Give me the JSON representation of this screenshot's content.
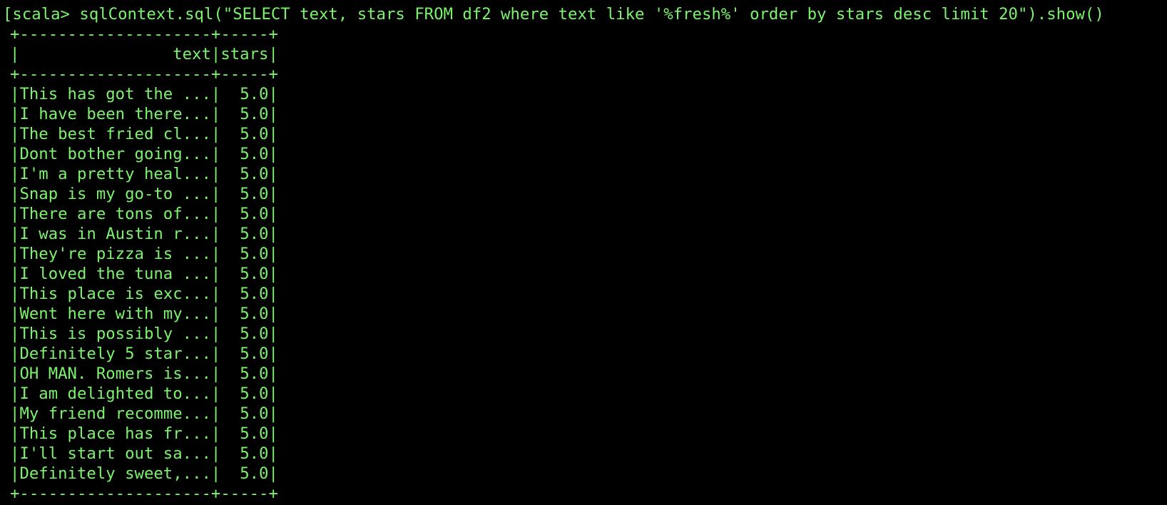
{
  "terminal": {
    "prompt": "[scala> ",
    "command": "sqlContext.sql(\"SELECT text, stars FROM df2 where text like '%fresh%' order by stars desc limit 20\").show()",
    "border": "+--------------------+-----+",
    "header": "|                text|stars|",
    "rows": [
      {
        "text": "This has got the ...",
        "stars": "5.0"
      },
      {
        "text": "I have been there...",
        "stars": "5.0"
      },
      {
        "text": "The best fried cl...",
        "stars": "5.0"
      },
      {
        "text": "Dont bother going...",
        "stars": "5.0"
      },
      {
        "text": "I'm a pretty heal...",
        "stars": "5.0"
      },
      {
        "text": "Snap is my go-to ...",
        "stars": "5.0"
      },
      {
        "text": "There are tons of...",
        "stars": "5.0"
      },
      {
        "text": "I was in Austin r...",
        "stars": "5.0"
      },
      {
        "text": "They're pizza is ...",
        "stars": "5.0"
      },
      {
        "text": "I loved the tuna ...",
        "stars": "5.0"
      },
      {
        "text": "This place is exc...",
        "stars": "5.0"
      },
      {
        "text": "Went here with my...",
        "stars": "5.0"
      },
      {
        "text": "This is possibly ...",
        "stars": "5.0"
      },
      {
        "text": "Definitely 5 star...",
        "stars": "5.0"
      },
      {
        "text": "OH MAN. Romers is...",
        "stars": "5.0"
      },
      {
        "text": "I am delighted to...",
        "stars": "5.0"
      },
      {
        "text": "My friend recomme...",
        "stars": "5.0"
      },
      {
        "text": "This place has fr...",
        "stars": "5.0"
      },
      {
        "text": "I'll start out sa...",
        "stars": "5.0"
      },
      {
        "text": "Definitely sweet,...",
        "stars": "5.0"
      }
    ],
    "colors": {
      "background": "#000000",
      "foreground": "#7CF36D"
    }
  }
}
